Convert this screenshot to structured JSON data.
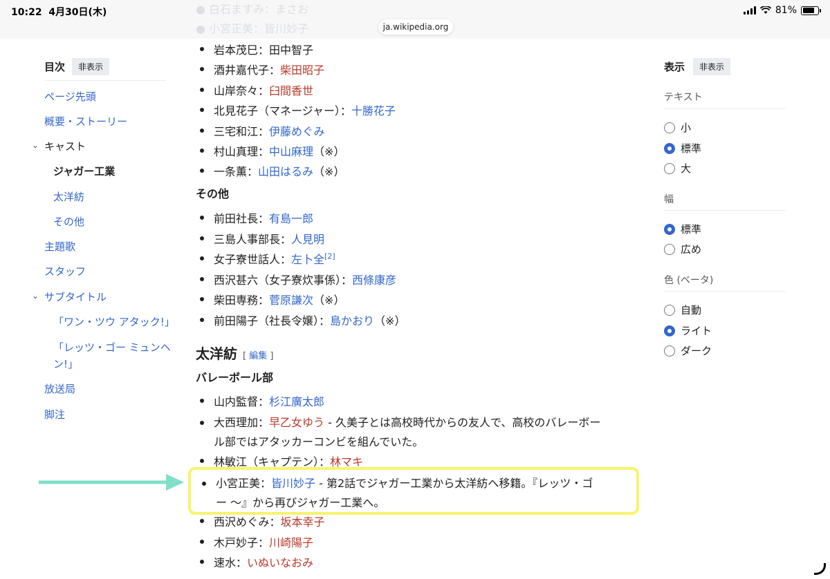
{
  "status": {
    "time": "10:22",
    "date": "4月30日(木)",
    "battery": "81%",
    "url": "ja.wikipedia.org"
  },
  "faded_lines": [
    "● 白石ますみ：まさお",
    "● 小宮正美：皆川妙子"
  ],
  "toc": {
    "title": "目次",
    "hide_label": "非表示",
    "items": [
      {
        "label": "ページ先頭"
      },
      {
        "label": "概要・ストーリー"
      },
      {
        "label": "キャスト"
      },
      {
        "label": "ジャガー工業"
      },
      {
        "label": "太洋紡"
      },
      {
        "label": "その他"
      },
      {
        "label": "主題歌"
      },
      {
        "label": "スタッフ"
      },
      {
        "label": "サブタイトル"
      },
      {
        "label": "「ワン・ツウ アタック!」"
      },
      {
        "label": "「レッツ・ゴー ミュンヘ",
        "label2": "ン!」"
      },
      {
        "label": "放送局"
      },
      {
        "label": "脚注"
      }
    ]
  },
  "cast_jaguar": [
    {
      "role": "岩本茂巳：",
      "actor": "田中智子",
      "note": ""
    },
    {
      "role": "酒井嘉代子：",
      "actor": "柴田昭子",
      "note": ""
    },
    {
      "role": "山岸奈々：",
      "actor": "臼間香世",
      "note": ""
    },
    {
      "role": "北見花子（マネージャー）：",
      "actor": "十勝花子",
      "note": ""
    },
    {
      "role": "三宅和江：",
      "actor": "伊藤めぐみ",
      "note": ""
    },
    {
      "role": "村山真理：",
      "actor": "中山麻理",
      "note": "（※）"
    },
    {
      "role": "一条薫：",
      "actor": "山田はるみ",
      "note": "（※）"
    }
  ],
  "heading_other": "その他",
  "cast_other": [
    {
      "role": "前田社長：",
      "actor": "有島一郎",
      "note": ""
    },
    {
      "role": "三島人事部長：",
      "actor": "人見明",
      "note": ""
    },
    {
      "role": "女子寮世話人：",
      "actor": "左卜全",
      "note": "",
      "sup": "[2]"
    },
    {
      "role": "西沢甚六（女子寮炊事係）：",
      "actor": "西條康彦",
      "note": ""
    },
    {
      "role": "柴田専務：",
      "actor": "菅原謙次",
      "note": "（※）"
    },
    {
      "role": "前田陽子（社長令嬢）：",
      "actor": "島かおり",
      "note": "（※）"
    }
  ],
  "section_taiyo": {
    "title": "太洋紡",
    "edit_open": "[",
    "edit_label": "編集",
    "edit_close": "]"
  },
  "heading_volley": "バレーボール部",
  "cast_taiyo": [
    {
      "role": "山内監督：",
      "actor": "杉江廣太郎",
      "note": ""
    },
    {
      "role": "大西理加：",
      "actor": "早乙女ゆう",
      "note": " - 久美子とは高校時代からの友人で、高校のバレーボー",
      "note2": "ル部ではアタッカーコンビを組んでいた。"
    },
    {
      "role": "林敏江（キャプテン）：",
      "actor": "林マキ",
      "note": ""
    },
    {
      "role": "西沢めぐみ：",
      "actor": "坂本幸子",
      "note": ""
    },
    {
      "role": "木戸妙子：",
      "actor": "川崎陽子",
      "note": ""
    },
    {
      "role": "速水：",
      "actor": "いぬいなおみ",
      "note": ""
    }
  ],
  "highlight": {
    "role": "小宮正美：",
    "actor": "皆川妙子",
    "note": " - 第2話でジャガー工業から太洋紡へ移籍。『レッツ・ゴ",
    "note2": "ー 〜』から再びジャガー工業へ。"
  },
  "display_panel": {
    "title": "表示",
    "hide_label": "非表示",
    "text_label": "テキスト",
    "text_options": [
      "小",
      "標準",
      "大"
    ],
    "width_label": "幅",
    "width_options": [
      "標準",
      "広め"
    ],
    "color_label": "色 (ベータ)",
    "color_options": [
      "自動",
      "ライト",
      "ダーク"
    ]
  },
  "colors": {
    "link": "#3366cc",
    "redlink": "#ba3a2b",
    "highlight_border": "#f6f46d",
    "arrow": "#7fe0c8"
  }
}
